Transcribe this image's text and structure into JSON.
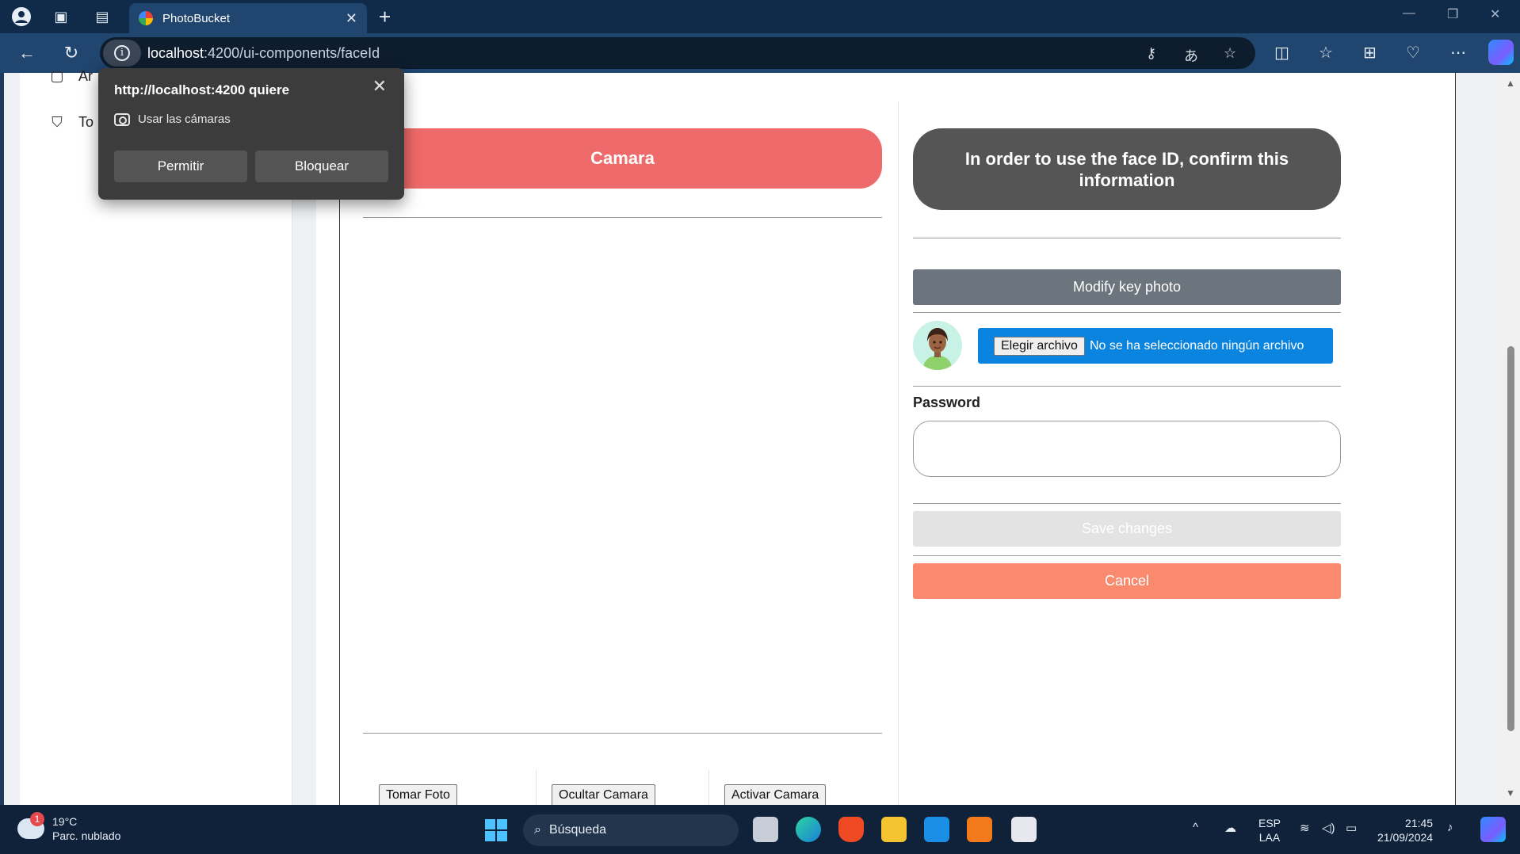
{
  "browser": {
    "tab_title": "PhotoBucket",
    "url_host": "localhost",
    "url_rest": ":4200/ui-components/faceId"
  },
  "sidebar": {
    "items": [
      {
        "label": "Ar",
        "icon": "app-icon"
      },
      {
        "label": "To",
        "icon": "paint-roller-icon"
      }
    ]
  },
  "camera": {
    "header": "Camara",
    "buttons": {
      "take_photo": "Tomar Foto",
      "hide_camera": "Ocultar Camara",
      "activate_camera": "Activar Camara"
    }
  },
  "face_id": {
    "header": "In order to use the face ID, confirm this information",
    "modify_label": "Modify key photo",
    "file_button": "Elegir archivo",
    "file_status": "No se ha seleccionado ningún archivo",
    "password_label": "Password",
    "password_value": "",
    "save_label": "Save changes",
    "cancel_label": "Cancel"
  },
  "permission_popup": {
    "title": "http://localhost:4200 quiere",
    "permission": "Usar las cámaras",
    "allow": "Permitir",
    "block": "Bloquear"
  },
  "taskbar": {
    "weather_badge": "1",
    "temperature": "19°C",
    "weather_desc": "Parc. nublado",
    "search_placeholder": "Búsqueda",
    "lang_top": "ESP",
    "lang_bottom": "LAA",
    "time": "21:45",
    "date": "21/09/2024"
  },
  "colors": {
    "camera_header": "#ef6a6a",
    "face_header": "#555555",
    "modify_button": "#6c757d",
    "file_input": "#0b84e0",
    "save_button": "#e3e3e3",
    "cancel_button": "#fa8a6d"
  }
}
